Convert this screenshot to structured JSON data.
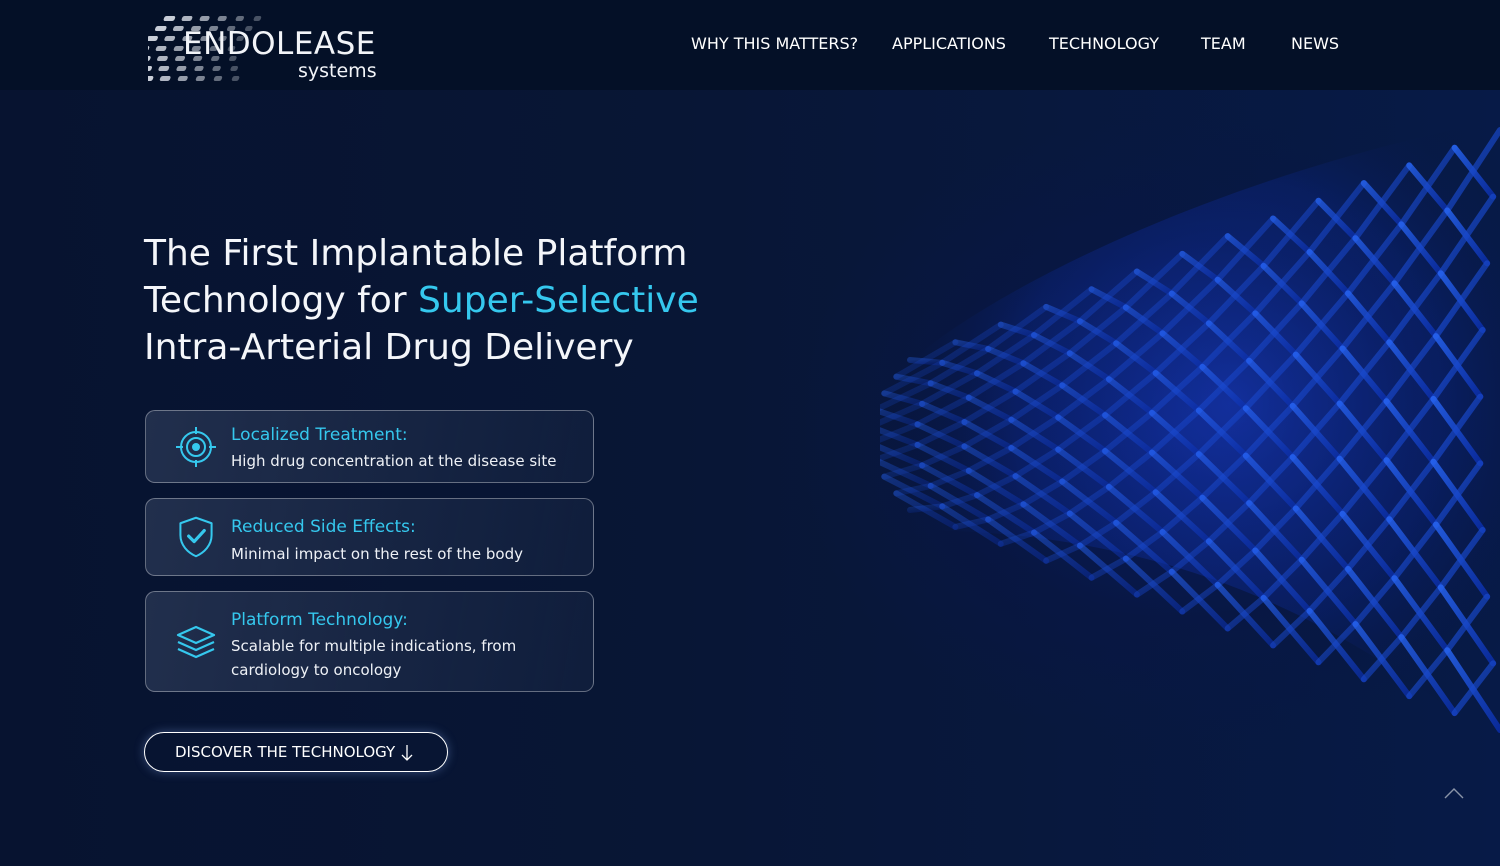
{
  "header": {
    "logo": {
      "word": "ENDOLEASE",
      "sub": "systems"
    },
    "nav": [
      {
        "label": "WHY THIS MATTERS?"
      },
      {
        "label": "APPLICATIONS"
      },
      {
        "label": "TECHNOLOGY"
      },
      {
        "label": "TEAM"
      },
      {
        "label": "NEWS"
      }
    ]
  },
  "hero": {
    "headline_part1": "The First Implantable Platform Technology for ",
    "headline_highlight": "Super-Selective",
    "headline_part2": " Intra-Arterial Drug Delivery",
    "accent_color": "#35c8ee",
    "cards": [
      {
        "icon": "target-icon",
        "title": "Localized Treatment:",
        "text": "High drug concentration at the disease site"
      },
      {
        "icon": "shield-check-icon",
        "title": "Reduced Side Effects:",
        "text": "Minimal impact on the rest of the body"
      },
      {
        "icon": "layers-icon",
        "title": "Platform Technology:",
        "text": "Scalable for multiple indications, from cardiology to oncology"
      }
    ],
    "cta": {
      "label": "DISCOVER THE TECHNOLOGY",
      "icon": "arrow-down-icon"
    }
  },
  "scroll_top": {
    "icon": "chevron-up-icon"
  }
}
